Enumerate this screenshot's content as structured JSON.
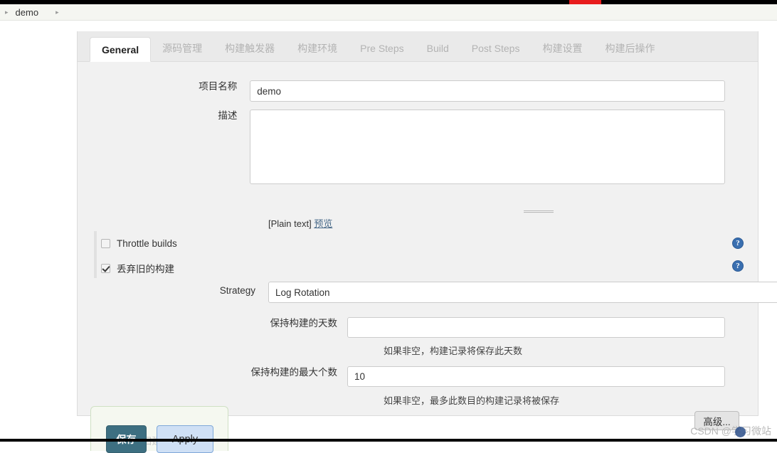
{
  "breadcrumb": {
    "arrow_first": "▸",
    "item": "demo",
    "arrow_second": "▸"
  },
  "tabs": [
    {
      "label": "General",
      "active": true
    },
    {
      "label": "源码管理",
      "active": false
    },
    {
      "label": "构建触发器",
      "active": false
    },
    {
      "label": "构建环境",
      "active": false
    },
    {
      "label": "Pre Steps",
      "active": false
    },
    {
      "label": "Build",
      "active": false
    },
    {
      "label": "Post Steps",
      "active": false
    },
    {
      "label": "构建设置",
      "active": false
    },
    {
      "label": "构建后操作",
      "active": false
    }
  ],
  "form": {
    "project_name_label": "项目名称",
    "project_name_value": "demo",
    "description_label": "描述",
    "description_value": "",
    "plain_text_note": "[Plain text]",
    "preview_link": "预览",
    "throttle_label": "Throttle builds",
    "throttle_checked": false,
    "discard_label": "丢弃旧的构建",
    "discard_checked": true,
    "help_icon_glyph": "?",
    "strategy_label": "Strategy",
    "strategy_value": "Log Rotation",
    "strategy_caret": "▼",
    "days_label": "保持构建的天数",
    "days_value": "",
    "days_hint": "如果非空，构建记录将保存此天数",
    "max_label": "保持构建的最大个数",
    "max_value": "10",
    "max_hint": "如果非空，最多此数目的构建记录将被保存",
    "advanced_button": "高级..."
  },
  "footer": {
    "save_label": "保存",
    "apply_label": "Apply",
    "obscured_text": "旧建"
  },
  "watermark": {
    "text": "CSDN @学习微站"
  },
  "colors": {
    "accent_save": "#3d6f81",
    "accent_apply": "#cfe0f5",
    "help_blue": "#3a6fb0",
    "link_blue": "#4a6b8a",
    "panel_bg": "#f1f1f1",
    "top_red": "#e81c1c"
  }
}
